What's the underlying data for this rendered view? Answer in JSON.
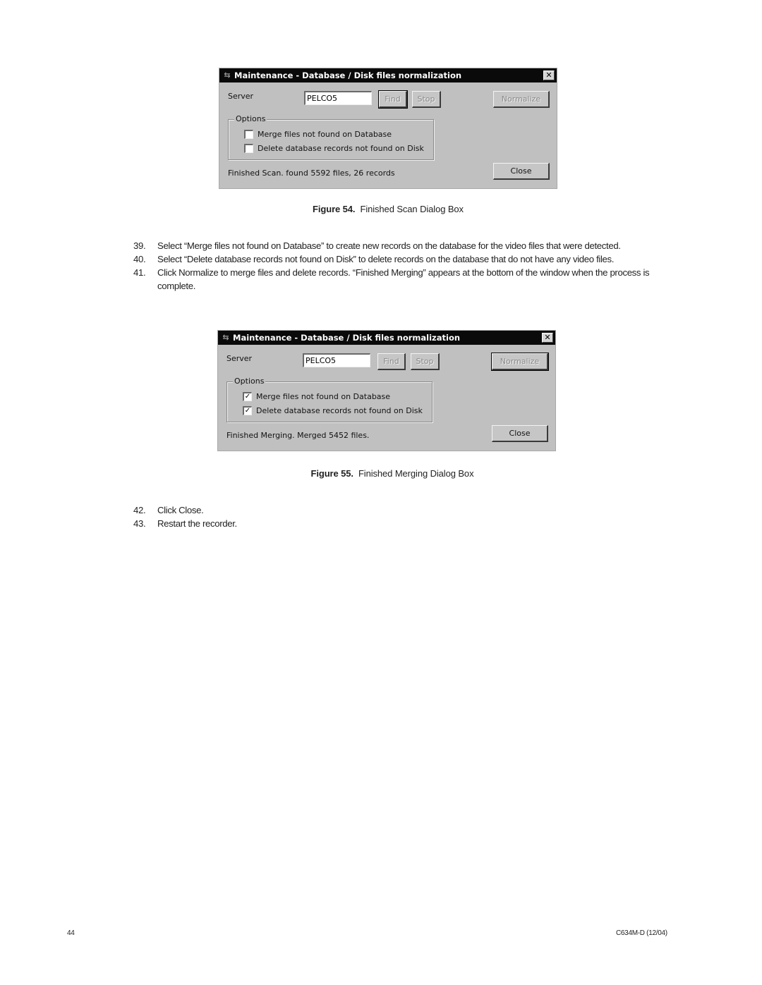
{
  "dialogs": [
    {
      "title": "Maintenance - Database / Disk files normalization",
      "title_icon": "arrows-icon",
      "close_glyph": "✕",
      "server_label": "Server",
      "server_value": "PELCO5",
      "find_label": "Find",
      "stop_label": "Stop",
      "normalize_label": "Normalize",
      "close_label": "Close",
      "options_legend": "Options",
      "options": [
        {
          "label": "Merge files not found on Database",
          "checked": false,
          "glyph": ""
        },
        {
          "label": "Delete database records not found on Disk",
          "checked": false,
          "glyph": ""
        }
      ],
      "status": "Finished Scan. found 5592 files, 26 records"
    },
    {
      "title": "Maintenance - Database / Disk files normalization",
      "title_icon": "arrows-icon",
      "close_glyph": "✕",
      "server_label": "Server",
      "server_value": "PELCO5",
      "find_label": "Find",
      "stop_label": "Stop",
      "normalize_label": "Normalize",
      "close_label": "Close",
      "options_legend": "Options",
      "options": [
        {
          "label": "Merge files not found on Database",
          "checked": true,
          "glyph": "✓"
        },
        {
          "label": "Delete database records not found on Disk",
          "checked": true,
          "glyph": "✓"
        }
      ],
      "status": "Finished Merging. Merged 5452 files."
    }
  ],
  "captions": [
    {
      "label": "Figure 54.",
      "text": "Finished Scan Dialog Box"
    },
    {
      "label": "Figure 55.",
      "text": "Finished Merging Dialog Box"
    }
  ],
  "steps_block_1": [
    {
      "num": "39.",
      "text": "Select “Merge files not found on Database” to create new records on the database for the video files that were detected."
    },
    {
      "num": "40.",
      "text": "Select “Delete database records not found on Disk” to delete records on the database that do not have any video files."
    },
    {
      "num": "41.",
      "text": "Click Normalize to merge files and delete records. “Finished Merging” appears at the bottom of the window when the process is complete."
    }
  ],
  "steps_block_2": [
    {
      "num": "42.",
      "text": "Click Close."
    },
    {
      "num": "43.",
      "text": "Restart the recorder."
    }
  ],
  "footer": {
    "page_number": "44",
    "doc_id": "C634M-D (12/04)"
  }
}
